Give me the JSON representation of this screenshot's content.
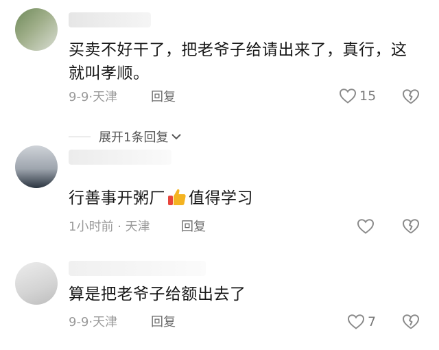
{
  "comments": [
    {
      "text": "买卖不好干了，把老爷子给请出来了，真行，这就叫孝顺。",
      "date": "9-9",
      "location": "天津",
      "reply_label": "回复",
      "likes": "15"
    },
    {
      "text_before": "行善事开粥厂",
      "emoji": "thumbs-up",
      "text_after": "值得学习",
      "date": "1小时前",
      "location": "天津",
      "reply_label": "回复",
      "likes": ""
    },
    {
      "text": "算是把老爷子给额出去了",
      "date": "9-9",
      "location": "天津",
      "reply_label": "回复",
      "likes": "7"
    }
  ],
  "expand_replies_label": "展开1条回复",
  "separator": "·",
  "colors": {
    "text": "#161616",
    "meta": "#9a9a9a",
    "icon": "#8a8a8a"
  }
}
